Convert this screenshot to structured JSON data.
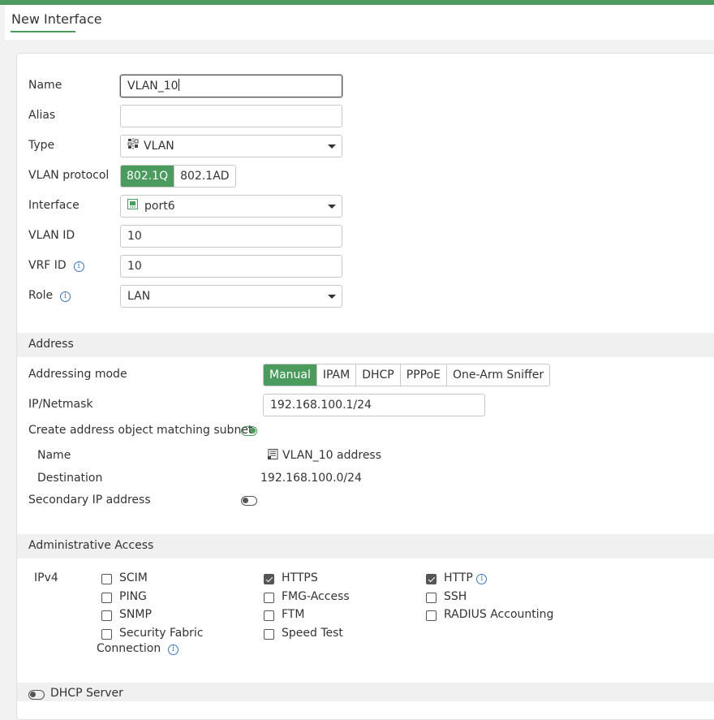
{
  "title": "New Interface",
  "form": {
    "name": {
      "label": "Name",
      "value": "VLAN_10"
    },
    "alias": {
      "label": "Alias",
      "value": ""
    },
    "type": {
      "label": "Type",
      "value": "VLAN",
      "icon": "vlan-icon"
    },
    "vlan_protocol": {
      "label": "VLAN protocol",
      "options": [
        "802.1Q",
        "802.1AD"
      ],
      "selected": "802.1Q"
    },
    "interface": {
      "label": "Interface",
      "value": "port6",
      "icon": "port-icon"
    },
    "vlan_id": {
      "label": "VLAN ID",
      "value": "10"
    },
    "vrf_id": {
      "label": "VRF ID",
      "value": "10"
    },
    "role": {
      "label": "Role",
      "value": "LAN"
    }
  },
  "address": {
    "heading": "Address",
    "addressing_mode": {
      "label": "Addressing mode",
      "options": [
        "Manual",
        "IPAM",
        "DHCP",
        "PPPoE",
        "One-Arm Sniffer"
      ],
      "selected": "Manual"
    },
    "ip_netmask": {
      "label": "IP/Netmask",
      "value": "192.168.100.1/24"
    },
    "create_object": {
      "label": "Create address object matching subnet",
      "enabled": true
    },
    "object_name": {
      "label": "Name",
      "value": "VLAN_10 address"
    },
    "destination": {
      "label": "Destination",
      "value": "192.168.100.0/24"
    },
    "secondary_ip": {
      "label": "Secondary IP address",
      "enabled": false
    }
  },
  "admin_access": {
    "heading": "Administrative Access",
    "ipv4_label": "IPv4",
    "columns": [
      [
        {
          "label": "SCIM",
          "checked": false
        },
        {
          "label": "PING",
          "checked": false
        },
        {
          "label": "SNMP",
          "checked": false
        },
        {
          "label": "Security Fabric",
          "label2": "Connection",
          "checked": false
        }
      ],
      [
        {
          "label": "HTTPS",
          "checked": true
        },
        {
          "label": "FMG-Access",
          "checked": false
        },
        {
          "label": "FTM",
          "checked": false
        },
        {
          "label": "Speed Test",
          "checked": false
        }
      ],
      [
        {
          "label": "HTTP",
          "checked": true
        },
        {
          "label": "SSH",
          "checked": false
        },
        {
          "label": "RADIUS Accounting",
          "checked": false
        }
      ]
    ]
  },
  "dhcp_server": {
    "label": "DHCP Server",
    "enabled": false
  },
  "colors": {
    "accent": "#4b9a5e",
    "info": "#3a78c0"
  }
}
